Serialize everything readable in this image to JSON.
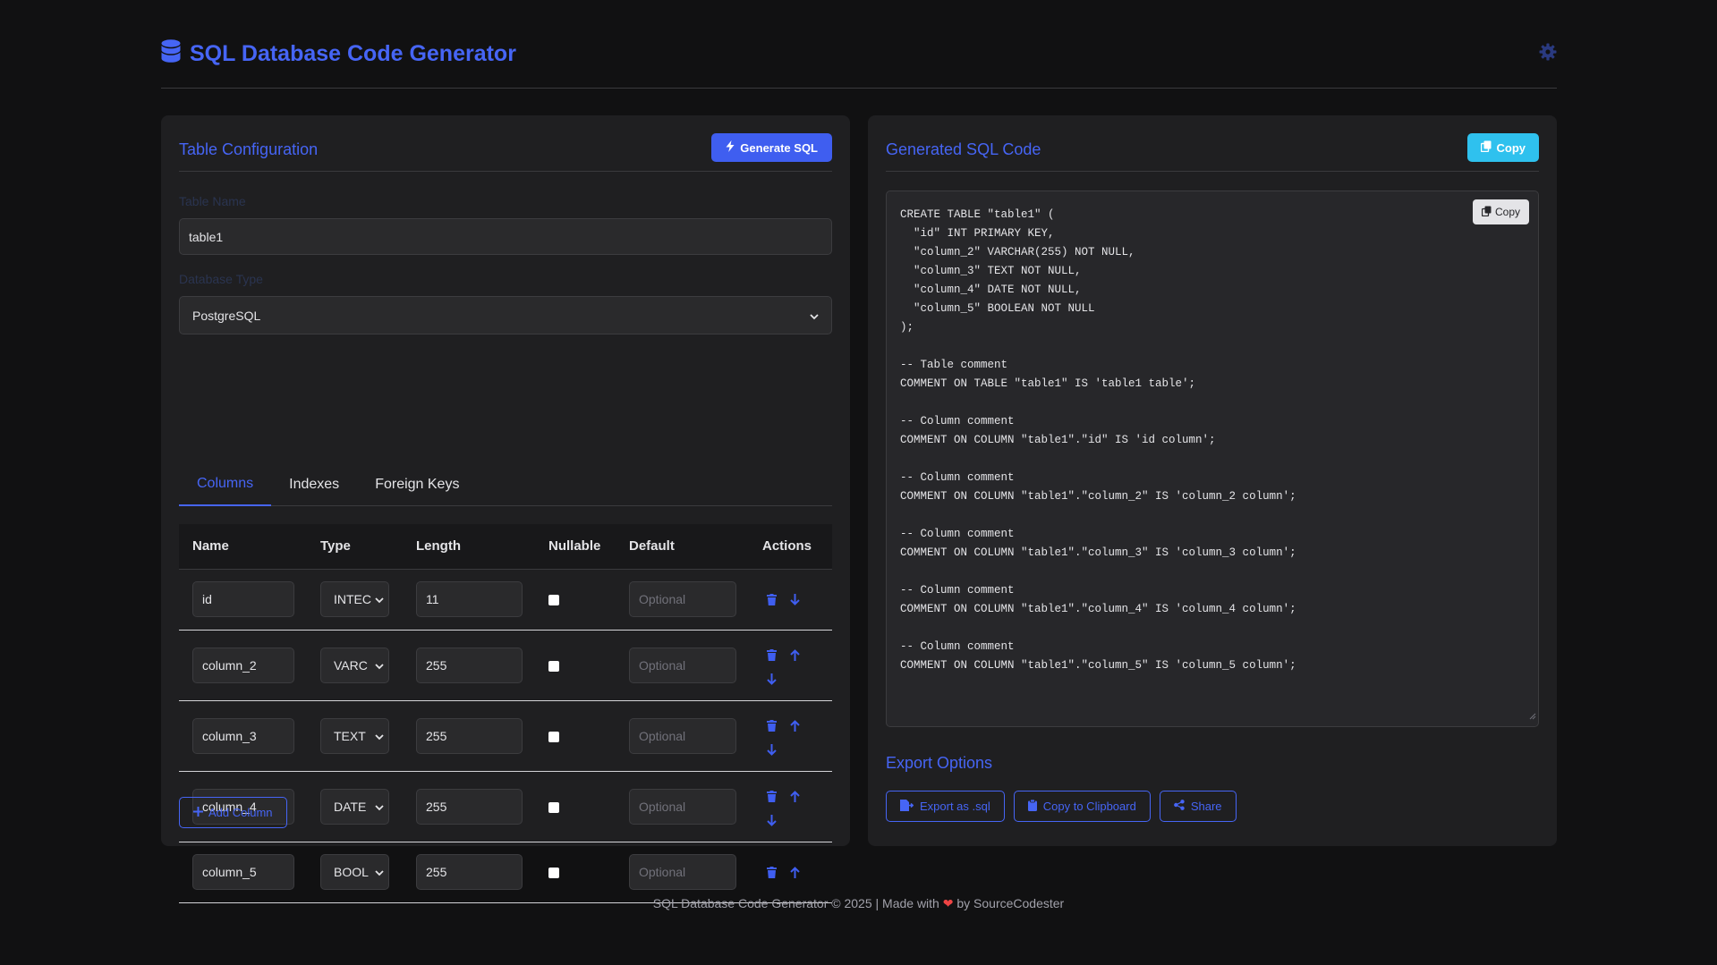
{
  "header": {
    "title": "SQL Database Code Generator",
    "logo_icon": "database-icon",
    "settings_icon": "gear-icon"
  },
  "config": {
    "title": "Table Configuration",
    "generate_label": "Generate SQL",
    "table_name_label": "Table Name",
    "table_name_value": "table1",
    "db_type_label": "Database Type",
    "db_type_value": "PostgreSQL",
    "tabs": [
      "Columns",
      "Indexes",
      "Foreign Keys"
    ],
    "active_tab": "Columns",
    "columns_header": {
      "name": "Name",
      "type": "Type",
      "length": "Length",
      "nullable": "Nullable",
      "default": "Default",
      "actions": "Actions"
    },
    "default_placeholder": "Optional",
    "rows": [
      {
        "name": "id",
        "type": "INTEC",
        "length": "11"
      },
      {
        "name": "column_2",
        "type": "VARC",
        "length": "255"
      },
      {
        "name": "column_3",
        "type": "TEXT",
        "length": "255"
      },
      {
        "name": "column_4",
        "type": "DATE",
        "length": "255"
      },
      {
        "name": "column_5",
        "type": "BOOL",
        "length": "255"
      }
    ],
    "add_column_label": "Add Column"
  },
  "output": {
    "title": "Generated SQL Code",
    "copy_label": "Copy",
    "inner_copy_label": "Copy",
    "code": "CREATE TABLE \"table1\" (\n  \"id\" INT PRIMARY KEY,\n  \"column_2\" VARCHAR(255) NOT NULL,\n  \"column_3\" TEXT NOT NULL,\n  \"column_4\" DATE NOT NULL,\n  \"column_5\" BOOLEAN NOT NULL\n);\n\n-- Table comment\nCOMMENT ON TABLE \"table1\" IS 'table1 table';\n\n-- Column comment\nCOMMENT ON COLUMN \"table1\".\"id\" IS 'id column';\n\n-- Column comment\nCOMMENT ON COLUMN \"table1\".\"column_2\" IS 'column_2 column';\n\n-- Column comment\nCOMMENT ON COLUMN \"table1\".\"column_3\" IS 'column_3 column';\n\n-- Column comment\nCOMMENT ON COLUMN \"table1\".\"column_4\" IS 'column_4 column';\n\n-- Column comment\nCOMMENT ON COLUMN \"table1\".\"column_5\" IS 'column_5 column';",
    "export_title": "Export Options",
    "export_sql_label": "Export as .sql",
    "copy_clipboard_label": "Copy to Clipboard",
    "share_label": "Share"
  },
  "footer": {
    "before": "SQL Database Code Generator © 2025 | Made with",
    "heart": "❤",
    "after": "by SourceCodester"
  },
  "colors": {
    "accent": "#4665f5",
    "cyan": "#2fc1ee",
    "background": "#111112",
    "panel": "#1f1f21"
  }
}
